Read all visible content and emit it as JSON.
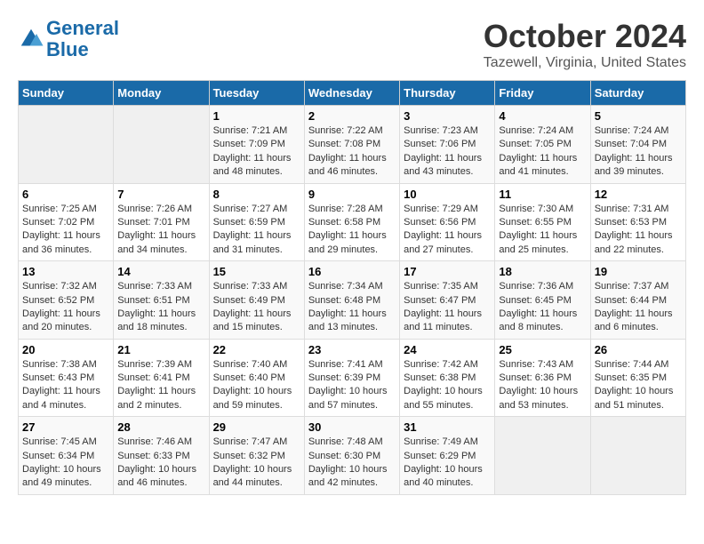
{
  "header": {
    "logo_line1": "General",
    "logo_line2": "Blue",
    "month": "October 2024",
    "location": "Tazewell, Virginia, United States"
  },
  "weekdays": [
    "Sunday",
    "Monday",
    "Tuesday",
    "Wednesday",
    "Thursday",
    "Friday",
    "Saturday"
  ],
  "weeks": [
    [
      {
        "day": "",
        "sunrise": "",
        "sunset": "",
        "daylight": ""
      },
      {
        "day": "",
        "sunrise": "",
        "sunset": "",
        "daylight": ""
      },
      {
        "day": "1",
        "sunrise": "Sunrise: 7:21 AM",
        "sunset": "Sunset: 7:09 PM",
        "daylight": "Daylight: 11 hours and 48 minutes."
      },
      {
        "day": "2",
        "sunrise": "Sunrise: 7:22 AM",
        "sunset": "Sunset: 7:08 PM",
        "daylight": "Daylight: 11 hours and 46 minutes."
      },
      {
        "day": "3",
        "sunrise": "Sunrise: 7:23 AM",
        "sunset": "Sunset: 7:06 PM",
        "daylight": "Daylight: 11 hours and 43 minutes."
      },
      {
        "day": "4",
        "sunrise": "Sunrise: 7:24 AM",
        "sunset": "Sunset: 7:05 PM",
        "daylight": "Daylight: 11 hours and 41 minutes."
      },
      {
        "day": "5",
        "sunrise": "Sunrise: 7:24 AM",
        "sunset": "Sunset: 7:04 PM",
        "daylight": "Daylight: 11 hours and 39 minutes."
      }
    ],
    [
      {
        "day": "6",
        "sunrise": "Sunrise: 7:25 AM",
        "sunset": "Sunset: 7:02 PM",
        "daylight": "Daylight: 11 hours and 36 minutes."
      },
      {
        "day": "7",
        "sunrise": "Sunrise: 7:26 AM",
        "sunset": "Sunset: 7:01 PM",
        "daylight": "Daylight: 11 hours and 34 minutes."
      },
      {
        "day": "8",
        "sunrise": "Sunrise: 7:27 AM",
        "sunset": "Sunset: 6:59 PM",
        "daylight": "Daylight: 11 hours and 31 minutes."
      },
      {
        "day": "9",
        "sunrise": "Sunrise: 7:28 AM",
        "sunset": "Sunset: 6:58 PM",
        "daylight": "Daylight: 11 hours and 29 minutes."
      },
      {
        "day": "10",
        "sunrise": "Sunrise: 7:29 AM",
        "sunset": "Sunset: 6:56 PM",
        "daylight": "Daylight: 11 hours and 27 minutes."
      },
      {
        "day": "11",
        "sunrise": "Sunrise: 7:30 AM",
        "sunset": "Sunset: 6:55 PM",
        "daylight": "Daylight: 11 hours and 25 minutes."
      },
      {
        "day": "12",
        "sunrise": "Sunrise: 7:31 AM",
        "sunset": "Sunset: 6:53 PM",
        "daylight": "Daylight: 11 hours and 22 minutes."
      }
    ],
    [
      {
        "day": "13",
        "sunrise": "Sunrise: 7:32 AM",
        "sunset": "Sunset: 6:52 PM",
        "daylight": "Daylight: 11 hours and 20 minutes."
      },
      {
        "day": "14",
        "sunrise": "Sunrise: 7:33 AM",
        "sunset": "Sunset: 6:51 PM",
        "daylight": "Daylight: 11 hours and 18 minutes."
      },
      {
        "day": "15",
        "sunrise": "Sunrise: 7:33 AM",
        "sunset": "Sunset: 6:49 PM",
        "daylight": "Daylight: 11 hours and 15 minutes."
      },
      {
        "day": "16",
        "sunrise": "Sunrise: 7:34 AM",
        "sunset": "Sunset: 6:48 PM",
        "daylight": "Daylight: 11 hours and 13 minutes."
      },
      {
        "day": "17",
        "sunrise": "Sunrise: 7:35 AM",
        "sunset": "Sunset: 6:47 PM",
        "daylight": "Daylight: 11 hours and 11 minutes."
      },
      {
        "day": "18",
        "sunrise": "Sunrise: 7:36 AM",
        "sunset": "Sunset: 6:45 PM",
        "daylight": "Daylight: 11 hours and 8 minutes."
      },
      {
        "day": "19",
        "sunrise": "Sunrise: 7:37 AM",
        "sunset": "Sunset: 6:44 PM",
        "daylight": "Daylight: 11 hours and 6 minutes."
      }
    ],
    [
      {
        "day": "20",
        "sunrise": "Sunrise: 7:38 AM",
        "sunset": "Sunset: 6:43 PM",
        "daylight": "Daylight: 11 hours and 4 minutes."
      },
      {
        "day": "21",
        "sunrise": "Sunrise: 7:39 AM",
        "sunset": "Sunset: 6:41 PM",
        "daylight": "Daylight: 11 hours and 2 minutes."
      },
      {
        "day": "22",
        "sunrise": "Sunrise: 7:40 AM",
        "sunset": "Sunset: 6:40 PM",
        "daylight": "Daylight: 10 hours and 59 minutes."
      },
      {
        "day": "23",
        "sunrise": "Sunrise: 7:41 AM",
        "sunset": "Sunset: 6:39 PM",
        "daylight": "Daylight: 10 hours and 57 minutes."
      },
      {
        "day": "24",
        "sunrise": "Sunrise: 7:42 AM",
        "sunset": "Sunset: 6:38 PM",
        "daylight": "Daylight: 10 hours and 55 minutes."
      },
      {
        "day": "25",
        "sunrise": "Sunrise: 7:43 AM",
        "sunset": "Sunset: 6:36 PM",
        "daylight": "Daylight: 10 hours and 53 minutes."
      },
      {
        "day": "26",
        "sunrise": "Sunrise: 7:44 AM",
        "sunset": "Sunset: 6:35 PM",
        "daylight": "Daylight: 10 hours and 51 minutes."
      }
    ],
    [
      {
        "day": "27",
        "sunrise": "Sunrise: 7:45 AM",
        "sunset": "Sunset: 6:34 PM",
        "daylight": "Daylight: 10 hours and 49 minutes."
      },
      {
        "day": "28",
        "sunrise": "Sunrise: 7:46 AM",
        "sunset": "Sunset: 6:33 PM",
        "daylight": "Daylight: 10 hours and 46 minutes."
      },
      {
        "day": "29",
        "sunrise": "Sunrise: 7:47 AM",
        "sunset": "Sunset: 6:32 PM",
        "daylight": "Daylight: 10 hours and 44 minutes."
      },
      {
        "day": "30",
        "sunrise": "Sunrise: 7:48 AM",
        "sunset": "Sunset: 6:30 PM",
        "daylight": "Daylight: 10 hours and 42 minutes."
      },
      {
        "day": "31",
        "sunrise": "Sunrise: 7:49 AM",
        "sunset": "Sunset: 6:29 PM",
        "daylight": "Daylight: 10 hours and 40 minutes."
      },
      {
        "day": "",
        "sunrise": "",
        "sunset": "",
        "daylight": ""
      },
      {
        "day": "",
        "sunrise": "",
        "sunset": "",
        "daylight": ""
      }
    ]
  ]
}
